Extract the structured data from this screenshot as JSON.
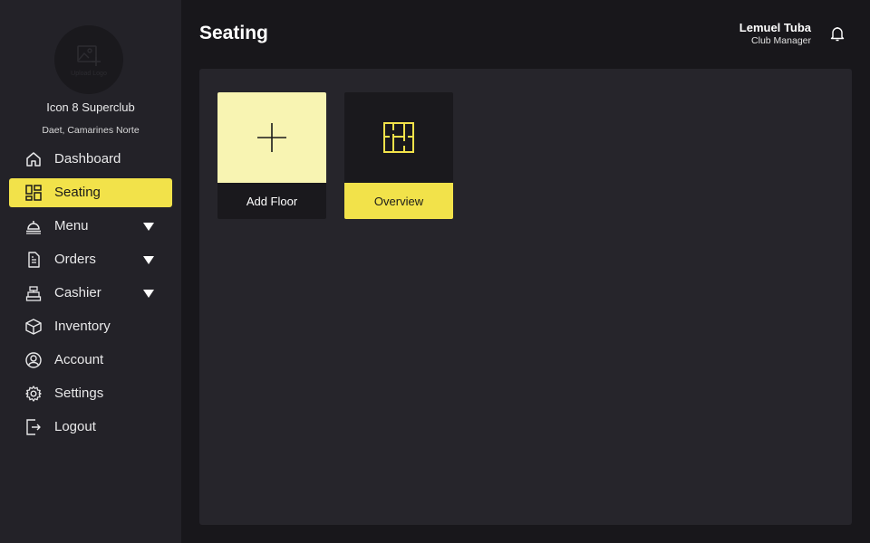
{
  "sidebar": {
    "logo_placeholder": "Upload Logo",
    "club_name": "Icon 8 Superclub",
    "club_location": "Daet, Camarines Norte",
    "items": [
      {
        "label": "Dashboard",
        "icon": "home-icon"
      },
      {
        "label": "Seating",
        "icon": "layout-grid-icon",
        "active": true
      },
      {
        "label": "Menu",
        "icon": "cloche-icon",
        "has_submenu": true
      },
      {
        "label": "Orders",
        "icon": "document-icon",
        "has_submenu": true
      },
      {
        "label": "Cashier",
        "icon": "cash-register-icon",
        "has_submenu": true
      },
      {
        "label": "Inventory",
        "icon": "box-icon"
      },
      {
        "label": "Account",
        "icon": "user-circle-icon"
      },
      {
        "label": "Settings",
        "icon": "gear-icon"
      },
      {
        "label": "Logout",
        "icon": "logout-icon"
      }
    ]
  },
  "header": {
    "title": "Seating",
    "user_name": "Lemuel Tuba",
    "user_role": "Club Manager",
    "notification_icon": "bell-icon"
  },
  "cards": [
    {
      "label": "Add Floor",
      "icon": "plus-icon"
    },
    {
      "label": "Overview",
      "icon": "floor-plan-icon"
    }
  ],
  "colors": {
    "accent": "#f2e24a",
    "accent_light": "#f8f4b2",
    "sidebar_bg": "#232228",
    "page_bg": "#18171b",
    "panel_bg": "#26252b"
  }
}
